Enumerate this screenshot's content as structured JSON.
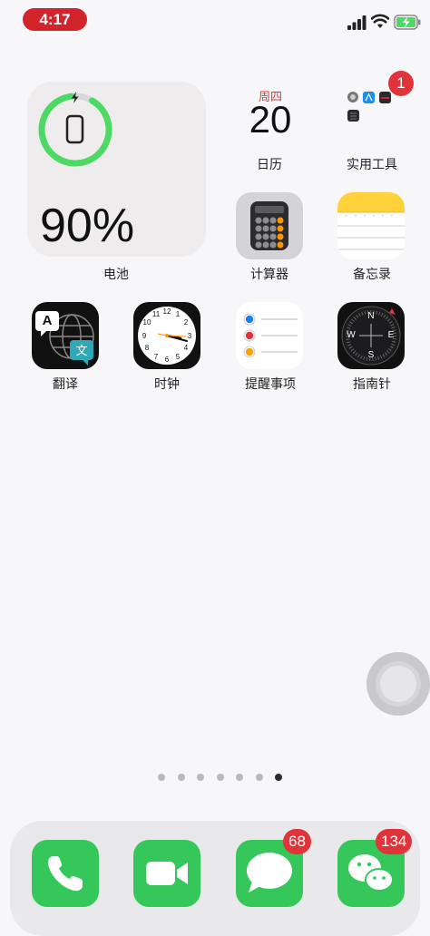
{
  "status_bar": {
    "time": "4:17"
  },
  "battery_widget": {
    "percent": "90%",
    "label": "电池"
  },
  "calendar": {
    "weekday": "周四",
    "date": "20",
    "label": "日历"
  },
  "utilities": {
    "label": "实用工具",
    "badge": "1"
  },
  "apps": {
    "calculator": "计算器",
    "notes": "备忘录",
    "translate": "翻译",
    "clock": "时钟",
    "reminders": "提醒事项",
    "compass": "指南针"
  },
  "translate_icon": {
    "left_letter": "A",
    "right_letter": "文"
  },
  "compass_icon": {
    "n": "N",
    "e": "E",
    "s": "S",
    "w": "W"
  },
  "page_indicator": {
    "count": 7,
    "current": 7
  },
  "dock": {
    "messages_badge": "68",
    "wechat_badge": "134"
  },
  "colors": {
    "time_pill": "#d3242c",
    "badge": "#e0343a",
    "green_app": "#35c759",
    "battery_ring": "#4cd964"
  }
}
